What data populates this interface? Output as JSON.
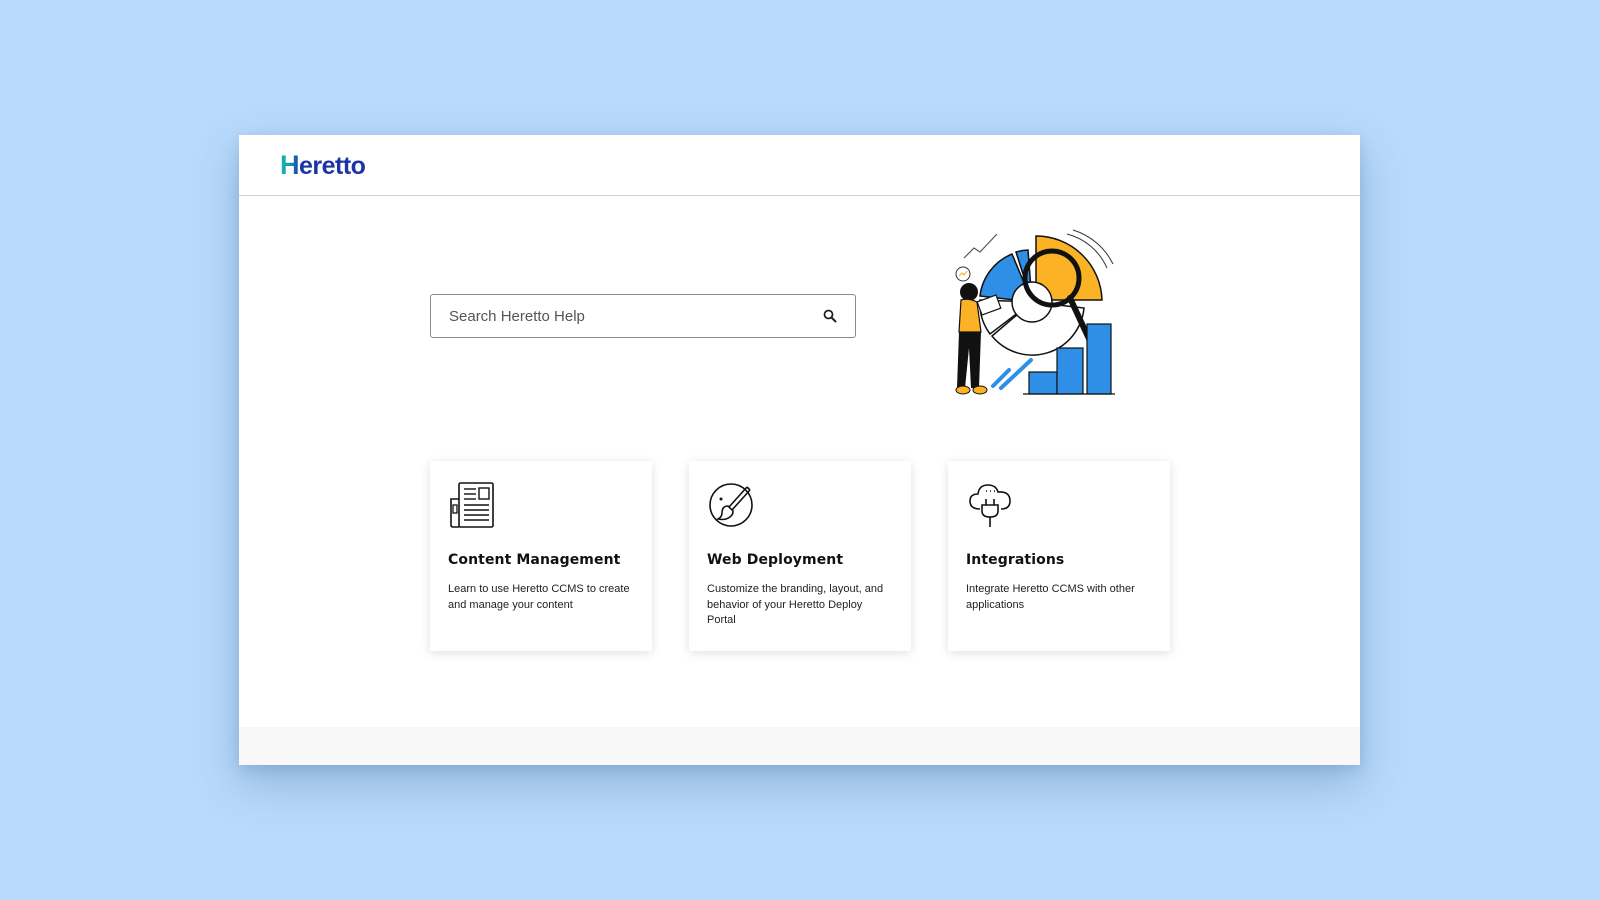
{
  "header": {
    "logo_initial": "H",
    "logo_rest": "eretto"
  },
  "search": {
    "placeholder": "Search Heretto Help",
    "icon": "search-icon"
  },
  "illustration": {
    "icon": "data-analysis-illustration",
    "colors": {
      "blue": "#2f8fe6",
      "yellow": "#fbb325",
      "outline": "#111111"
    }
  },
  "cards": [
    {
      "icon": "newspaper-icon",
      "title": "Content Management",
      "description": "Learn to use Heretto CCMS to create and manage your content"
    },
    {
      "icon": "paint-brush-palette-icon",
      "title": "Web Deployment",
      "description": "Customize the branding, layout, and behavior of your Heretto Deploy Portal"
    },
    {
      "icon": "cloud-plug-icon",
      "title": "Integrations",
      "description": "Integrate Heretto CCMS with other applications"
    }
  ],
  "colors": {
    "background": "#b8dafb",
    "brand_blue": "#1c34a8",
    "brand_teal": "#1ab3a6"
  }
}
